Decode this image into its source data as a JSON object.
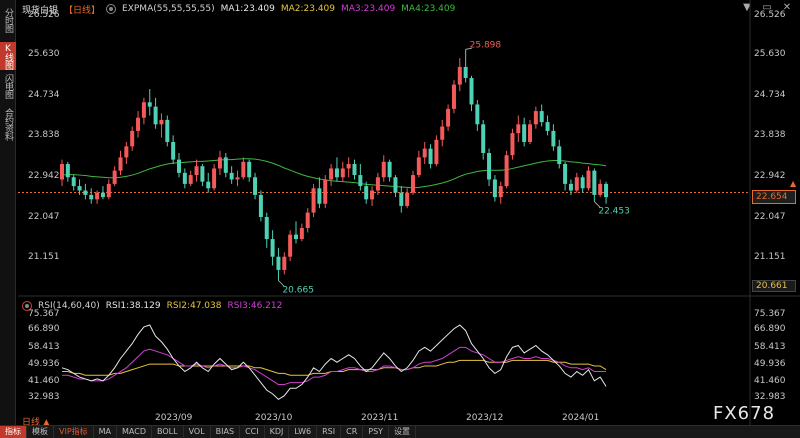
{
  "header": {
    "title": "现货白银",
    "period": "【日线】",
    "expma_label": "EXPMA(55,55,55,55)",
    "ma1": "MA1:23.409",
    "ma2": "MA2:23.409",
    "ma3": "MA3:23.409",
    "ma4": "MA4:23.409"
  },
  "colors": {
    "up": "#f45a5a",
    "down": "#4fd1b5",
    "ma_line": "#3fb83f",
    "rsi1": "#e6e6e6",
    "rsi2": "#e6c43c",
    "rsi3": "#d040d0",
    "accent": "#e56a2e"
  },
  "left_tabs": [
    "分时图",
    "K线图",
    "闪电图",
    "合约资料"
  ],
  "window_controls": [
    "▼",
    "▭",
    "✕"
  ],
  "main_axis": {
    "labels": [
      "26.526",
      "25.630",
      "24.734",
      "23.838",
      "22.942",
      "22.047",
      "21.151",
      "20.661"
    ],
    "values": [
      26.526,
      25.63,
      24.734,
      23.838,
      22.942,
      22.047,
      21.151
    ]
  },
  "current_price": "22.654",
  "low_badge": "20.661",
  "annotations": {
    "high": "25.898",
    "low": "20.665",
    "recent_low": "22.453"
  },
  "sub_header": {
    "rsi_label": "RSI(14,60,40)",
    "rsi1": "RSI1:38.129",
    "rsi2": "RSI2:47.038",
    "rsi3": "RSI3:46.212"
  },
  "sub_axis": {
    "labels": [
      "75.367",
      "66.890",
      "58.413",
      "49.936",
      "41.460",
      "32.983"
    ],
    "values": [
      75.367,
      66.89,
      58.413,
      49.936,
      41.46,
      32.983
    ]
  },
  "x_labels": [
    "2023/09",
    "2023/10",
    "2023/11",
    "2023/12",
    "2024/01"
  ],
  "period_toggle": "日线 ▲",
  "bottom_tabs": [
    "指标",
    "模板",
    "VIP指标",
    "MA",
    "MACD",
    "BOLL",
    "VOL",
    "BIAS",
    "CCI",
    "KDJ",
    "LW6",
    "RSI",
    "CR",
    "PSY",
    "设置"
  ],
  "watermark": "FX678",
  "chart_data": {
    "type": "candlestick",
    "x_ticks": [
      "2023/09",
      "2023/10",
      "2023/11",
      "2023/12",
      "2024/01"
    ],
    "price_range": [
      20.4,
      26.7
    ],
    "rsi_range": [
      28,
      78
    ],
    "candles": [
      [
        22.95,
        23.4,
        22.8,
        23.3
      ],
      [
        23.3,
        23.35,
        22.9,
        23.0
      ],
      [
        23.0,
        23.05,
        22.7,
        22.8
      ],
      [
        22.8,
        22.95,
        22.6,
        22.7
      ],
      [
        22.7,
        22.85,
        22.5,
        22.6
      ],
      [
        22.6,
        22.75,
        22.4,
        22.5
      ],
      [
        22.5,
        22.7,
        22.4,
        22.65
      ],
      [
        22.65,
        22.8,
        22.5,
        22.55
      ],
      [
        22.55,
        22.95,
        22.5,
        22.85
      ],
      [
        22.85,
        23.25,
        22.8,
        23.15
      ],
      [
        23.15,
        23.6,
        23.05,
        23.45
      ],
      [
        23.45,
        23.8,
        23.3,
        23.7
      ],
      [
        23.7,
        24.15,
        23.6,
        24.05
      ],
      [
        24.05,
        24.5,
        23.9,
        24.35
      ],
      [
        24.35,
        24.8,
        24.2,
        24.7
      ],
      [
        24.7,
        25.0,
        24.4,
        24.6
      ],
      [
        24.6,
        24.8,
        24.1,
        24.2
      ],
      [
        24.2,
        24.45,
        23.9,
        24.3
      ],
      [
        24.3,
        24.4,
        23.7,
        23.8
      ],
      [
        23.8,
        23.95,
        23.3,
        23.4
      ],
      [
        23.4,
        23.55,
        23.0,
        23.1
      ],
      [
        23.1,
        23.2,
        22.75,
        22.85
      ],
      [
        22.85,
        23.15,
        22.8,
        23.05
      ],
      [
        23.05,
        23.4,
        22.9,
        23.25
      ],
      [
        23.25,
        23.3,
        22.8,
        22.9
      ],
      [
        22.9,
        23.1,
        22.65,
        22.75
      ],
      [
        22.75,
        23.3,
        22.7,
        23.2
      ],
      [
        23.2,
        23.6,
        23.05,
        23.45
      ],
      [
        23.45,
        23.55,
        23.0,
        23.1
      ],
      [
        23.1,
        23.25,
        22.85,
        22.95
      ],
      [
        22.95,
        23.15,
        22.8,
        23.0
      ],
      [
        23.0,
        23.45,
        22.95,
        23.35
      ],
      [
        23.35,
        23.4,
        22.9,
        23.0
      ],
      [
        23.0,
        23.1,
        22.5,
        22.6
      ],
      [
        22.6,
        22.7,
        22.0,
        22.1
      ],
      [
        22.1,
        22.2,
        21.4,
        21.6
      ],
      [
        21.6,
        21.8,
        21.0,
        21.2
      ],
      [
        21.2,
        21.4,
        20.66,
        20.9
      ],
      [
        20.9,
        21.3,
        20.8,
        21.2
      ],
      [
        21.2,
        21.8,
        21.1,
        21.7
      ],
      [
        21.7,
        22.0,
        21.5,
        21.6
      ],
      [
        21.6,
        21.95,
        21.55,
        21.85
      ],
      [
        21.85,
        22.3,
        21.75,
        22.2
      ],
      [
        22.2,
        22.85,
        22.1,
        22.75
      ],
      [
        22.75,
        23.0,
        22.3,
        22.4
      ],
      [
        22.4,
        23.05,
        22.3,
        22.95
      ],
      [
        22.95,
        23.3,
        22.8,
        23.2
      ],
      [
        23.2,
        23.45,
        22.9,
        23.0
      ],
      [
        23.0,
        23.35,
        22.9,
        23.2
      ],
      [
        23.2,
        23.45,
        23.0,
        23.3
      ],
      [
        23.3,
        23.4,
        22.95,
        23.05
      ],
      [
        23.05,
        23.3,
        22.7,
        22.8
      ],
      [
        22.8,
        22.9,
        22.4,
        22.5
      ],
      [
        22.5,
        22.8,
        22.35,
        22.7
      ],
      [
        22.7,
        23.1,
        22.6,
        23.0
      ],
      [
        23.0,
        23.5,
        22.9,
        23.35
      ],
      [
        23.35,
        23.4,
        22.9,
        23.0
      ],
      [
        23.0,
        23.05,
        22.55,
        22.65
      ],
      [
        22.65,
        22.8,
        22.2,
        22.35
      ],
      [
        22.35,
        22.75,
        22.3,
        22.65
      ],
      [
        22.65,
        23.15,
        22.6,
        23.05
      ],
      [
        23.05,
        23.6,
        23.0,
        23.45
      ],
      [
        23.45,
        23.8,
        23.3,
        23.65
      ],
      [
        23.65,
        23.75,
        23.2,
        23.3
      ],
      [
        23.3,
        23.95,
        23.25,
        23.85
      ],
      [
        23.85,
        24.3,
        23.7,
        24.15
      ],
      [
        24.15,
        24.65,
        24.05,
        24.55
      ],
      [
        24.55,
        25.2,
        24.45,
        25.1
      ],
      [
        25.1,
        25.7,
        24.95,
        25.5
      ],
      [
        25.5,
        25.9,
        25.15,
        25.25
      ],
      [
        25.25,
        25.3,
        24.5,
        24.65
      ],
      [
        24.65,
        24.75,
        24.05,
        24.2
      ],
      [
        24.2,
        24.3,
        23.4,
        23.55
      ],
      [
        23.55,
        23.65,
        22.8,
        22.95
      ],
      [
        22.95,
        23.05,
        22.45,
        22.55
      ],
      [
        22.55,
        22.9,
        22.4,
        22.8
      ],
      [
        22.8,
        23.6,
        22.75,
        23.5
      ],
      [
        23.5,
        24.1,
        23.4,
        24.0
      ],
      [
        24.0,
        24.4,
        23.8,
        24.2
      ],
      [
        24.2,
        24.35,
        23.7,
        23.8
      ],
      [
        23.8,
        24.3,
        23.75,
        24.2
      ],
      [
        24.2,
        24.6,
        24.1,
        24.5
      ],
      [
        24.5,
        24.65,
        24.15,
        24.25
      ],
      [
        24.25,
        24.4,
        23.95,
        24.05
      ],
      [
        24.05,
        24.2,
        23.6,
        23.7
      ],
      [
        23.7,
        23.85,
        23.2,
        23.3
      ],
      [
        23.3,
        23.35,
        22.7,
        22.85
      ],
      [
        22.85,
        22.95,
        22.6,
        22.7
      ],
      [
        22.7,
        23.1,
        22.65,
        23.0
      ],
      [
        23.0,
        23.05,
        22.65,
        22.75
      ],
      [
        22.75,
        23.25,
        22.7,
        23.15
      ],
      [
        23.15,
        23.2,
        22.45,
        22.6
      ],
      [
        22.6,
        22.95,
        22.55,
        22.85
      ],
      [
        22.85,
        22.9,
        22.4,
        22.55
      ]
    ],
    "ma": [
      23.05,
      23.06,
      23.06,
      23.05,
      23.04,
      23.02,
      23.01,
      23.0,
      22.99,
      22.99,
      23.0,
      23.02,
      23.05,
      23.09,
      23.14,
      23.19,
      23.23,
      23.27,
      23.3,
      23.32,
      23.33,
      23.34,
      23.35,
      23.36,
      23.36,
      23.37,
      23.38,
      23.39,
      23.4,
      23.4,
      23.41,
      23.42,
      23.42,
      23.41,
      23.39,
      23.36,
      23.32,
      23.27,
      23.21,
      23.16,
      23.11,
      23.06,
      23.02,
      22.99,
      22.96,
      22.94,
      22.92,
      22.91,
      22.9,
      22.89,
      22.88,
      22.86,
      22.84,
      22.83,
      22.82,
      22.81,
      22.8,
      22.79,
      22.78,
      22.77,
      22.76,
      22.77,
      22.79,
      22.81,
      22.84,
      22.87,
      22.91,
      22.96,
      23.02,
      23.07,
      23.1,
      23.13,
      23.15,
      23.16,
      23.16,
      23.16,
      23.17,
      23.2,
      23.23,
      23.26,
      23.29,
      23.32,
      23.35,
      23.37,
      23.38,
      23.38,
      23.37,
      23.35,
      23.34,
      23.32,
      23.31,
      23.29,
      23.28,
      23.26
    ],
    "rsi1": [
      48,
      47,
      45,
      43,
      42,
      41,
      42,
      41,
      44,
      48,
      53,
      57,
      61,
      66,
      70,
      71,
      65,
      62,
      58,
      53,
      49,
      46,
      48,
      51,
      48,
      46,
      50,
      53,
      50,
      47,
      48,
      51,
      48,
      44,
      40,
      36,
      34,
      31,
      33,
      37,
      37,
      39,
      43,
      48,
      46,
      50,
      53,
      51,
      53,
      55,
      53,
      49,
      46,
      48,
      52,
      56,
      53,
      49,
      46,
      48,
      52,
      57,
      59,
      57,
      60,
      63,
      66,
      69,
      71,
      68,
      61,
      57,
      53,
      48,
      45,
      47,
      54,
      59,
      60,
      56,
      58,
      60,
      57,
      55,
      52,
      49,
      45,
      43,
      46,
      44,
      47,
      41,
      43,
      38
    ],
    "rsi2": [
      46,
      46,
      45,
      45,
      44,
      44,
      44,
      44,
      44,
      45,
      45,
      46,
      47,
      48,
      49,
      50,
      50,
      50,
      50,
      50,
      49,
      49,
      49,
      49,
      49,
      49,
      49,
      49,
      49,
      49,
      49,
      49,
      49,
      48,
      48,
      47,
      46,
      45,
      45,
      44,
      44,
      44,
      44,
      45,
      45,
      45,
      46,
      46,
      46,
      47,
      47,
      47,
      47,
      47,
      47,
      48,
      48,
      48,
      47,
      47,
      48,
      48,
      49,
      49,
      49,
      50,
      51,
      51,
      52,
      52,
      52,
      52,
      52,
      51,
      51,
      51,
      51,
      52,
      52,
      52,
      52,
      52,
      52,
      52,
      51,
      51,
      51,
      50,
      50,
      50,
      50,
      49,
      49,
      47
    ],
    "rsi3": [
      44,
      44,
      43,
      42,
      42,
      41,
      41,
      41,
      42,
      44,
      46,
      48,
      51,
      54,
      57,
      58,
      57,
      56,
      55,
      53,
      51,
      49,
      49,
      50,
      49,
      48,
      49,
      50,
      49,
      48,
      48,
      49,
      48,
      47,
      45,
      43,
      41,
      39,
      39,
      40,
      40,
      40,
      41,
      43,
      43,
      44,
      46,
      46,
      47,
      48,
      48,
      47,
      46,
      46,
      47,
      49,
      49,
      48,
      47,
      47,
      48,
      50,
      51,
      51,
      52,
      53,
      55,
      57,
      59,
      59,
      57,
      56,
      55,
      53,
      51,
      51,
      52,
      53,
      54,
      53,
      53,
      54,
      53,
      53,
      52,
      51,
      49,
      48,
      48,
      47,
      48,
      46,
      46,
      46
    ]
  }
}
